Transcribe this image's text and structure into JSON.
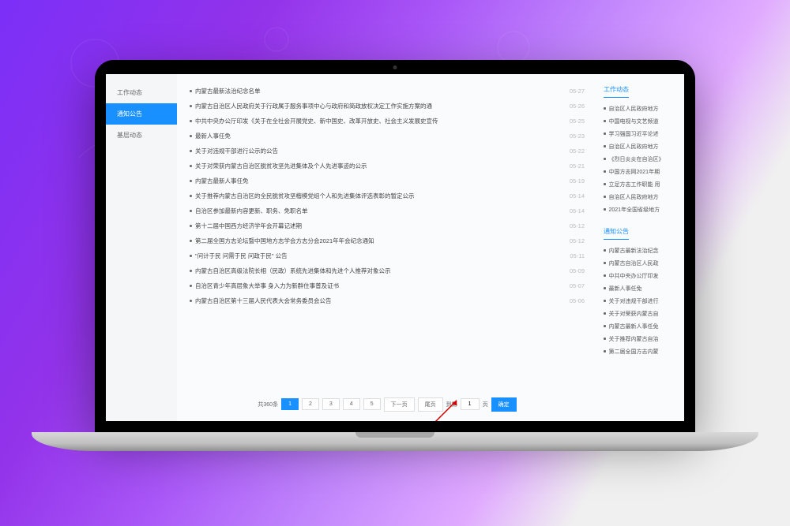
{
  "sidebar": {
    "items": [
      {
        "label": "工作动态",
        "active": false
      },
      {
        "label": "通知公告",
        "active": true
      },
      {
        "label": "基层动态",
        "active": false
      }
    ]
  },
  "list": [
    {
      "title": "内蒙古最新法治纪念名单",
      "date": "05-27"
    },
    {
      "title": "内蒙古自治区人民政府关于行政属于服务事项中心与政府和简政放权决定工作实施方案的通",
      "date": "05-26"
    },
    {
      "title": "中共中央办公厅印发《关于在全社会开展党史、新中国史、改革开放史、社会主义发展史宣传",
      "date": "05-25"
    },
    {
      "title": "最新人事任免",
      "date": "05-23"
    },
    {
      "title": "关于对违规干部进行公示的公告",
      "date": "05-22"
    },
    {
      "title": "关于对荣获内蒙古自治区脱贫攻坚先进集体及个人先进事迹的公示",
      "date": "05-21"
    },
    {
      "title": "内蒙古最新人事任免",
      "date": "05-19"
    },
    {
      "title": "关于推荐内蒙古自治区的全民脱贫攻坚楷模党组个人和先进集体评选表彰的暂定公示",
      "date": "05-14"
    },
    {
      "title": "自治区参加最新内容更新、职务、免职名单",
      "date": "05-14"
    },
    {
      "title": "第十二届中国西方经济学年会开幕记述期",
      "date": "05-12"
    },
    {
      "title": "第二届全国方志论坛暨中国地方志学会方志分会2021年年会纪念通知",
      "date": "05-12"
    },
    {
      "title": "\"问计于民 问需于民 问政于民\" 公告",
      "date": "05-11"
    },
    {
      "title": "内蒙古自治区高级法院长相（民政）系统先进集体和先进个人推荐对象公示",
      "date": "05-09"
    },
    {
      "title": "自治区青少年高层象大举事 身入力为新群住事普及证书",
      "date": "05-07"
    },
    {
      "title": "内蒙古自治区第十三届人民代表大会常务委员会公告",
      "date": "05-06"
    }
  ],
  "pagination": {
    "total_label": "共360条",
    "pages": [
      "1",
      "2",
      "3",
      "4",
      "5"
    ],
    "next_label": "下一页",
    "last_label": "尾页",
    "goto_label": "到第",
    "input_value": "1",
    "page_suffix": "页",
    "confirm_label": "确定"
  },
  "panels": [
    {
      "title": "工作动态",
      "items": [
        "自治区人民政府地方",
        "中国电视与文艺频道",
        "学习强国习近平论述",
        "自治区人民政府地方",
        "《烈日炎炎在自治区》",
        "中国方志网2021年期",
        "立足方志工作职能 用",
        "自治区人民政府地方",
        "2021年全国省级地方"
      ]
    },
    {
      "title": "通知公告",
      "items": [
        "内蒙古最新法治纪念",
        "内蒙古自治区人民政",
        "中共中央办公厅印发",
        "最新人事任免",
        "关于对违规干部进行",
        "关于对荣获内蒙古自",
        "内蒙古最新人事任免",
        "关于推荐内蒙古自治",
        "第二届全国方志内蒙"
      ]
    }
  ]
}
